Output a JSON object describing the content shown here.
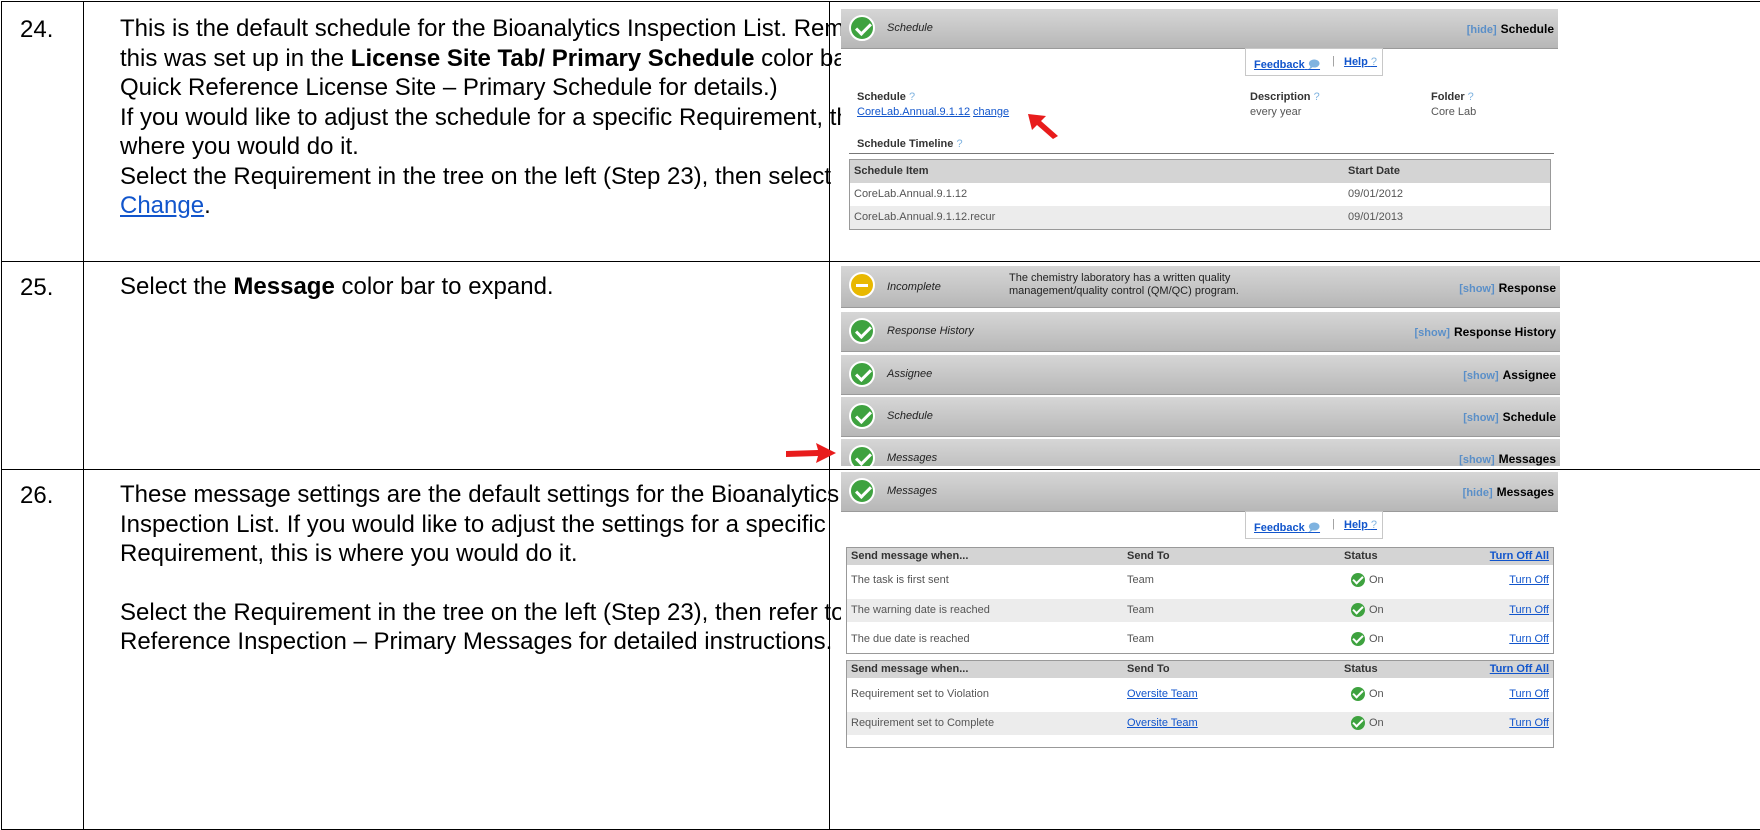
{
  "rows": [
    {
      "number": "24.",
      "text": {
        "p1a": "This is the default schedule for the Bioanalytics Inspection List. Remember, this was set up in the ",
        "p1b": "License Site Tab/ Primary Schedule",
        "p1c": " color bar.  (See Quick Reference License Site – Primary Schedule for details.)",
        "p2": "If you would like to adjust the schedule for a specific Requirement, this is where you would do it.",
        "p3a": "Select the Requirement in the tree on the left (Step 23), then select ",
        "p3link": "Change",
        "p3c": "."
      }
    },
    {
      "number": "25.",
      "text": {
        "p1a": "Select the ",
        "p1b": "Message",
        "p1c": " color bar to expand."
      }
    },
    {
      "number": "26.",
      "text": {
        "p1": "These message settings are the default settings for the Bioanalytics Inspection List.  If you would like to adjust the settings for a specific Requirement, this is where you would do it.",
        "p2": "Select the Requirement in the tree on the left (Step 23), then refer to Quick Reference Inspection – Primary Messages for detailed instructions."
      }
    }
  ],
  "shot1": {
    "bar": {
      "title": "Schedule",
      "toggle": "[hide]",
      "right": "Schedule"
    },
    "feedback": "Feedback",
    "help": "Help",
    "schedule_label": "Schedule",
    "schedule_value": "CoreLab.Annual.9.1.12",
    "change": "change",
    "description_label": "Description",
    "description_value": "every year",
    "folder_label": "Folder",
    "folder_value": "Core Lab",
    "timeline_label": "Schedule Timeline",
    "table": {
      "headers": [
        "Schedule Item",
        "Start Date"
      ],
      "rows": [
        [
          "CoreLab.Annual.9.1.12",
          "09/01/2012"
        ],
        [
          "CoreLab.Annual.9.1.12.recur",
          "09/01/2013"
        ]
      ]
    }
  },
  "shot2": {
    "bars": [
      {
        "icon": "minus",
        "title": "Incomplete",
        "desc": "The chemistry laboratory has a written quality management/quality control (QM/QC) program.",
        "toggle": "[show]",
        "right": "Response"
      },
      {
        "icon": "check",
        "title": "Response History",
        "toggle": "[show]",
        "right": "Response History"
      },
      {
        "icon": "check",
        "title": "Assignee",
        "toggle": "[show]",
        "right": "Assignee"
      },
      {
        "icon": "check",
        "title": "Schedule",
        "toggle": "[show]",
        "right": "Schedule"
      },
      {
        "icon": "check",
        "title": "Messages",
        "toggle": "[show]",
        "right": "Messages"
      }
    ]
  },
  "shot3": {
    "bar": {
      "title": "Messages",
      "toggle": "[hide]",
      "right": "Messages"
    },
    "feedback": "Feedback",
    "help": "Help",
    "table1": {
      "headers": [
        "Send message when...",
        "Send To",
        "Status",
        "Turn Off All"
      ],
      "rows": [
        {
          "when": "The task is first sent",
          "to": "Team",
          "status": "On",
          "action": "Turn Off"
        },
        {
          "when": "The warning date is reached",
          "to": "Team",
          "status": "On",
          "action": "Turn Off"
        },
        {
          "when": "The due date is reached",
          "to": "Team",
          "status": "On",
          "action": "Turn Off"
        }
      ]
    },
    "table2": {
      "headers": [
        "Send message when...",
        "Send To",
        "Status",
        "Turn Off All"
      ],
      "rows": [
        {
          "when": "Requirement set to Violation",
          "to": "Oversite Team",
          "status": "On",
          "action": "Turn Off"
        },
        {
          "when": "Requirement set to Complete",
          "to": "Oversite Team",
          "status": "On",
          "action": "Turn Off"
        }
      ]
    }
  },
  "colors": {
    "arrow": "#e81c1c",
    "check": "#3ea23f",
    "link": "#1155cc"
  }
}
